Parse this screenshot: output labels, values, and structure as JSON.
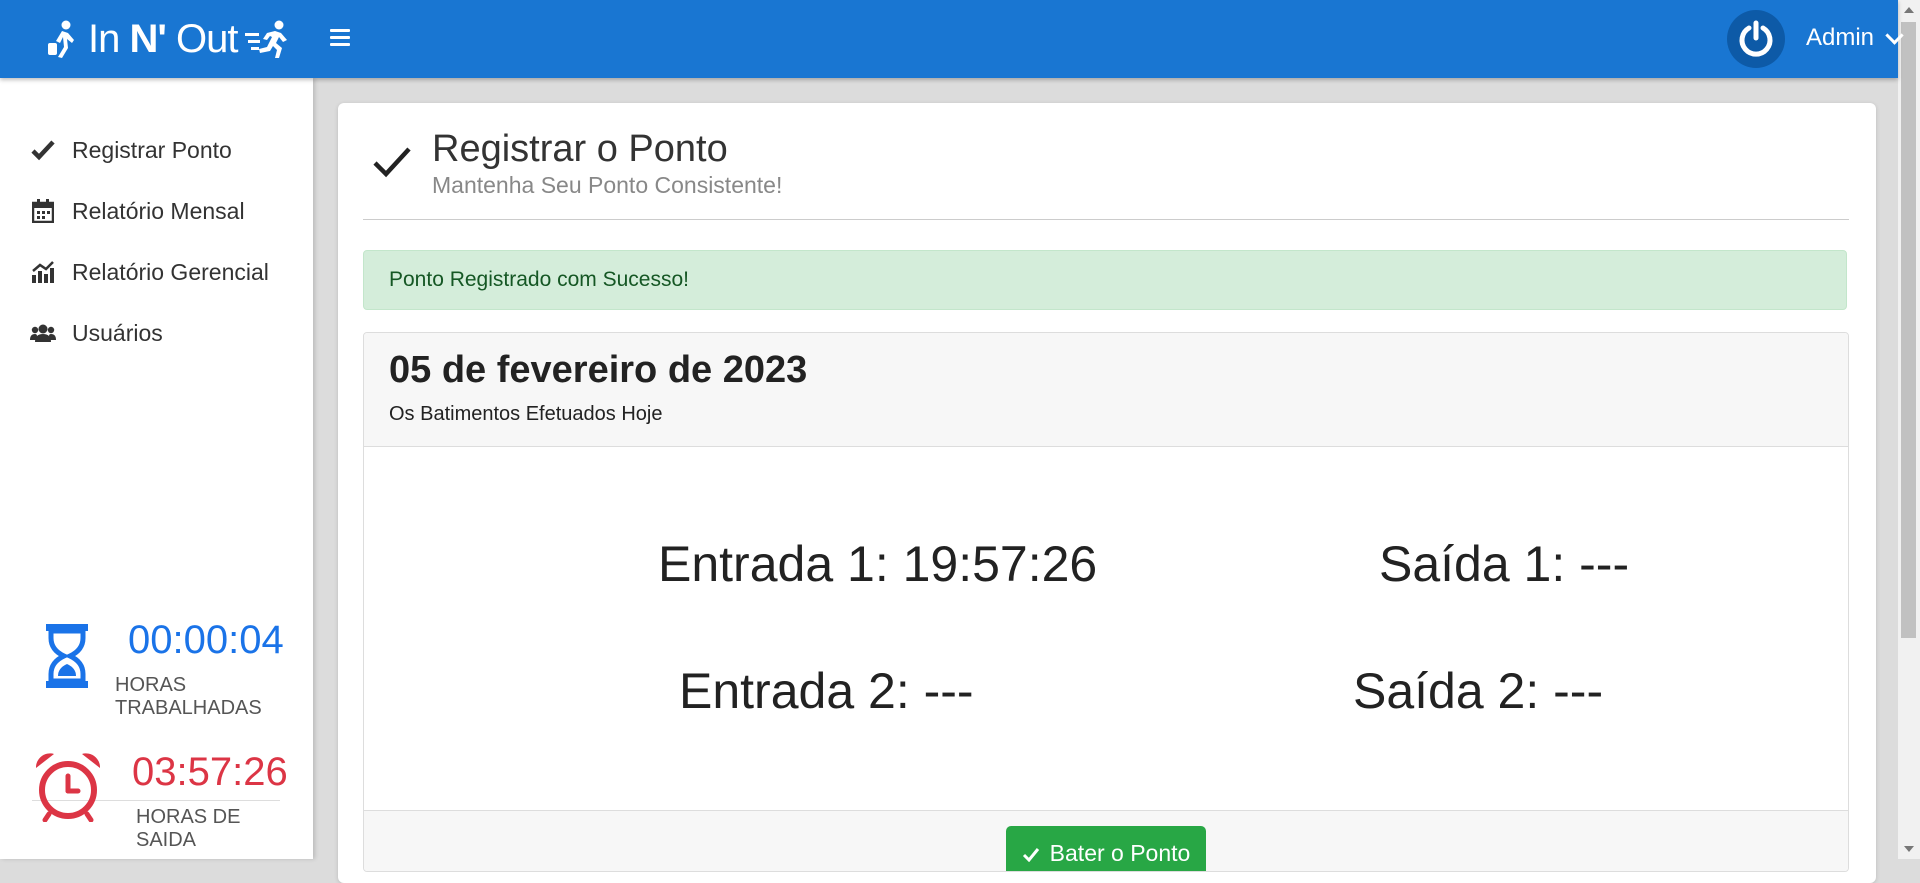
{
  "brand": {
    "name_pre": "In ",
    "name_bold": "N'",
    "name_post": " Out"
  },
  "header": {
    "user_name": "Admin"
  },
  "sidebar": {
    "items": [
      {
        "label": "Registrar Ponto",
        "icon": "check-icon"
      },
      {
        "label": "Relatório Mensal",
        "icon": "calendar-icon"
      },
      {
        "label": "Relatório Gerencial",
        "icon": "chart-icon"
      },
      {
        "label": "Usuários",
        "icon": "users-icon"
      }
    ],
    "worked": {
      "value": "00:00:04",
      "label": "HORAS TRABALHADAS",
      "color": "#1a73e8"
    },
    "exit": {
      "value": "03:57:26",
      "label": "HORAS DE SAIDA",
      "color": "#dc3545"
    }
  },
  "page": {
    "title": "Registrar o Ponto",
    "subtitle": "Mantenha Seu Ponto Consistente!",
    "alert": "Ponto Registrado com Sucesso!"
  },
  "panel": {
    "date": "05 de fevereiro de 2023",
    "subtitle": "Os Batimentos Efetuados Hoje",
    "entrada1": "Entrada 1: 19:57:26",
    "saida1": "Saída 1: ---",
    "entrada2": "Entrada 2: ---",
    "saida2": "Saída 2: ---",
    "button": "Bater o Ponto"
  },
  "colors": {
    "primary": "#1976d2",
    "success": "#28a745",
    "alert_bg": "#d4edda"
  }
}
